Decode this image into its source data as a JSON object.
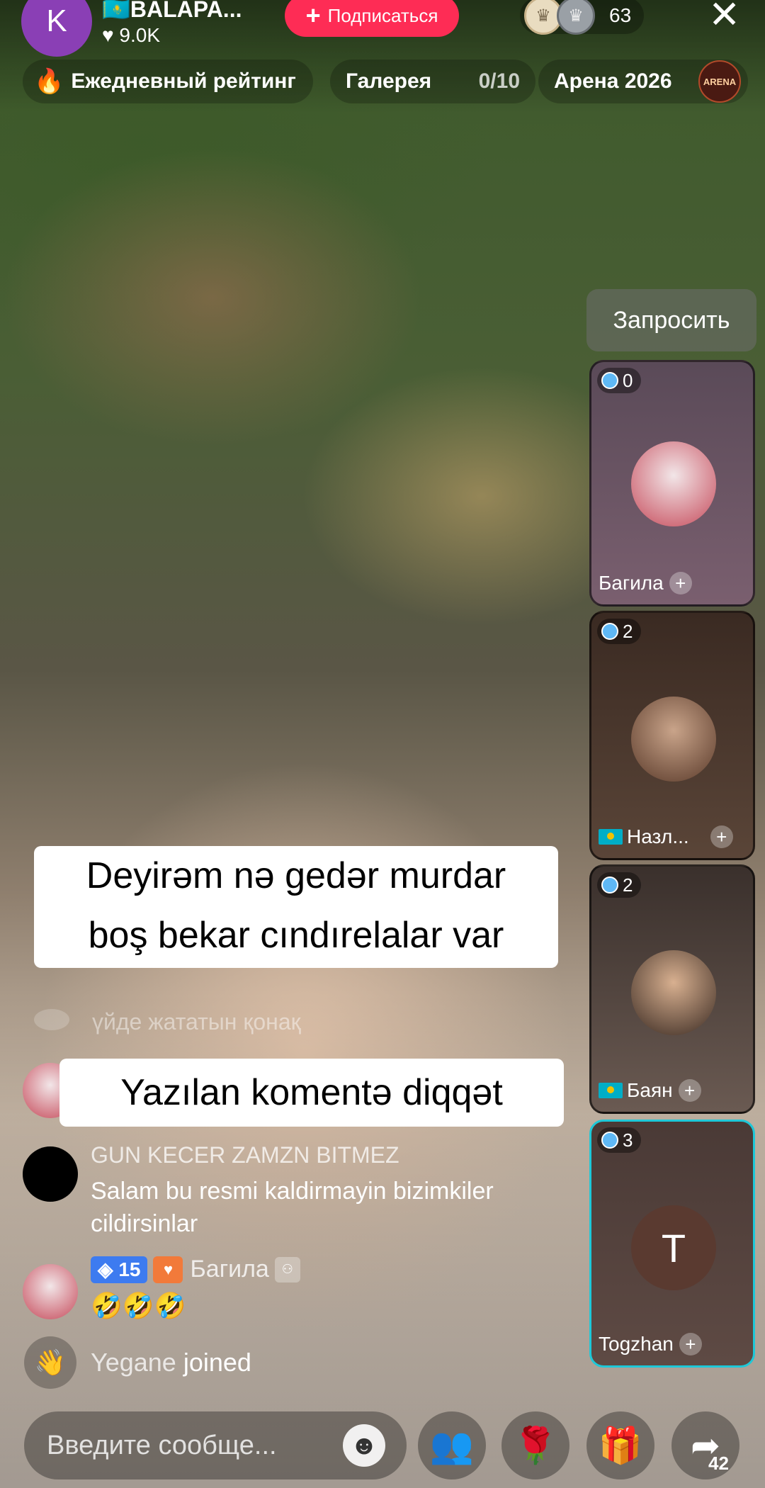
{
  "host": {
    "avatar_letter": "K",
    "name": "🇰🇿BALAPA...",
    "likes": "♥ 9.0K"
  },
  "subscribe_label": "Подписаться",
  "viewers_count": "63",
  "top_pills": {
    "rating": "Ежедневный рейтинг",
    "gallery": "Галерея",
    "gallery_count": "0/10",
    "arena": "Арена 2026",
    "arena_badge": "ARENA"
  },
  "request_label": "Запросить",
  "guests": [
    {
      "score": "0",
      "name": "Багила"
    },
    {
      "score": "2",
      "name": "Назл..."
    },
    {
      "score": "2",
      "name": "Баян"
    },
    {
      "score": "3",
      "name": "Togzhan",
      "avatar_letter": "T"
    }
  ],
  "captions": {
    "line1": "Deyirəm nə gedər murdar",
    "line2": "boş bekar cındırelalar var",
    "line3": "Yazılan komentə diqqət"
  },
  "comments": {
    "faded": "үйде жататын қонақ",
    "c2_name": "GUN KECER ZAMZN BITMEZ",
    "c2_text": "Salam bu resmi kaldirmayin bizimkiler cildirsinlar",
    "c3_level": "15",
    "c3_name": "Багила",
    "c3_text": "🤣🤣🤣",
    "joined_user": "Yegane",
    "joined_text": " joined"
  },
  "input_placeholder": "Введите сообще...",
  "share_count": "42",
  "colors": {
    "accent": "#fe2c55",
    "highlight": "#1ec8d8",
    "level": "#3d7bf0"
  }
}
